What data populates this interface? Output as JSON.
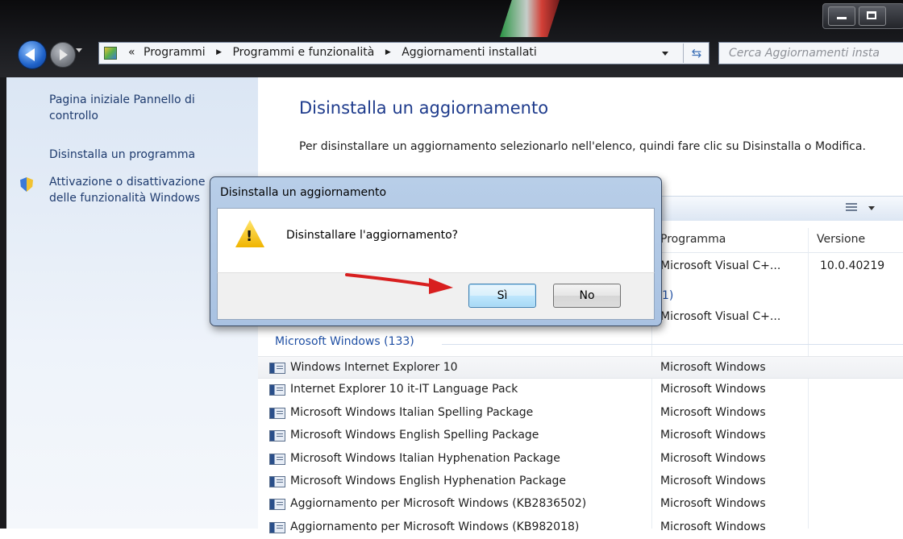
{
  "window": {
    "address": {
      "crumbs": [
        "«",
        "Programmi",
        "Programmi e funzionalità",
        "Aggiornamenti installati"
      ]
    },
    "search_placeholder": "Cerca Aggiornamenti insta"
  },
  "sidebar": {
    "home_link": "Pagina iniziale Pannello di controllo",
    "uninstall_program": "Disinstalla un programma",
    "toggle_features": "Attivazione o disattivazione delle funzionalità Windows"
  },
  "main": {
    "title": "Disinstalla un aggiornamento",
    "description": "Per disinstallare un aggiornamento selezionarlo nell'elenco, quindi fare clic su Disinstalla o Modifica.",
    "columns": {
      "program": "Programma",
      "version": "Versione"
    },
    "top_rows": [
      {
        "program": "Microsoft Visual C+...",
        "version": "10.0.40219"
      },
      {
        "group_tail": "1)",
        "program": "Microsoft Visual C+...",
        "version": ""
      }
    ],
    "group": "Microsoft Windows (133)",
    "updates": [
      {
        "name": "Windows Internet Explorer 10",
        "program": "Microsoft Windows"
      },
      {
        "name": "Internet Explorer 10 it-IT Language Pack",
        "program": "Microsoft Windows"
      },
      {
        "name": "Microsoft Windows Italian Spelling Package",
        "program": "Microsoft Windows"
      },
      {
        "name": "Microsoft Windows English Spelling Package",
        "program": "Microsoft Windows"
      },
      {
        "name": "Microsoft Windows Italian Hyphenation Package",
        "program": "Microsoft Windows"
      },
      {
        "name": "Microsoft Windows English Hyphenation Package",
        "program": "Microsoft Windows"
      },
      {
        "name": "Aggiornamento per Microsoft Windows (KB2836502)",
        "program": "Microsoft Windows"
      },
      {
        "name": "Aggiornamento per Microsoft Windows (KB982018)",
        "program": "Microsoft Windows"
      }
    ]
  },
  "dialog": {
    "title": "Disinstalla un aggiornamento",
    "message": "Disinstallare l'aggiornamento?",
    "yes_label": "Sì",
    "no_label": "No"
  },
  "colors": {
    "link": "#1e3b6e",
    "title": "#1e3b8c",
    "group": "#1f4fa3",
    "arrow": "#d81f1f"
  }
}
